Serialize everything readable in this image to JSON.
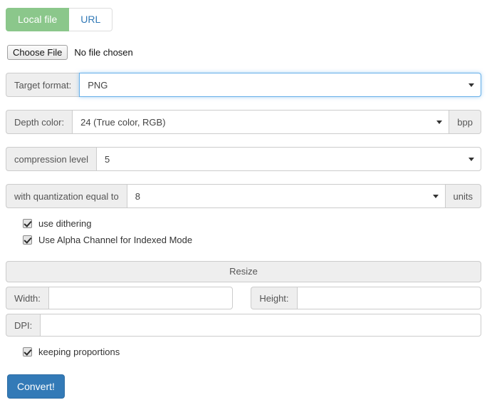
{
  "tabs": [
    {
      "label": "Local file",
      "active": true
    },
    {
      "label": "URL",
      "active": false
    }
  ],
  "file_input": {
    "button_label": "Choose File",
    "status_text": "No file chosen"
  },
  "fields": {
    "target_format": {
      "label": "Target format:",
      "value": "PNG",
      "focused": true
    },
    "depth_color": {
      "label": "Depth color:",
      "value": "24 (True color, RGB)",
      "unit": "bpp"
    },
    "compression": {
      "label": "compression level",
      "value": "5"
    },
    "quantization": {
      "label": "with quantization equal to",
      "value": "8",
      "unit": "units"
    }
  },
  "options": [
    {
      "label": "use dithering",
      "checked": true
    },
    {
      "label": "Use Alpha Channel for Indexed Mode",
      "checked": true
    }
  ],
  "resize": {
    "title": "Resize",
    "width": {
      "label": "Width:",
      "value": "",
      "placeholder": ""
    },
    "height": {
      "label": "Height:",
      "value": "",
      "placeholder": ""
    },
    "dpi": {
      "label": "DPI:",
      "value": "",
      "placeholder": ""
    },
    "keep_proportions": {
      "label": "keeping proportions",
      "checked": true
    }
  },
  "submit": {
    "label": "Convert!"
  },
  "colors": {
    "tab_active": "#8bc78b",
    "primary": "#337ab7",
    "focus_border": "#66afe9",
    "addon_bg": "#eeeeee",
    "border": "#cccccc"
  }
}
